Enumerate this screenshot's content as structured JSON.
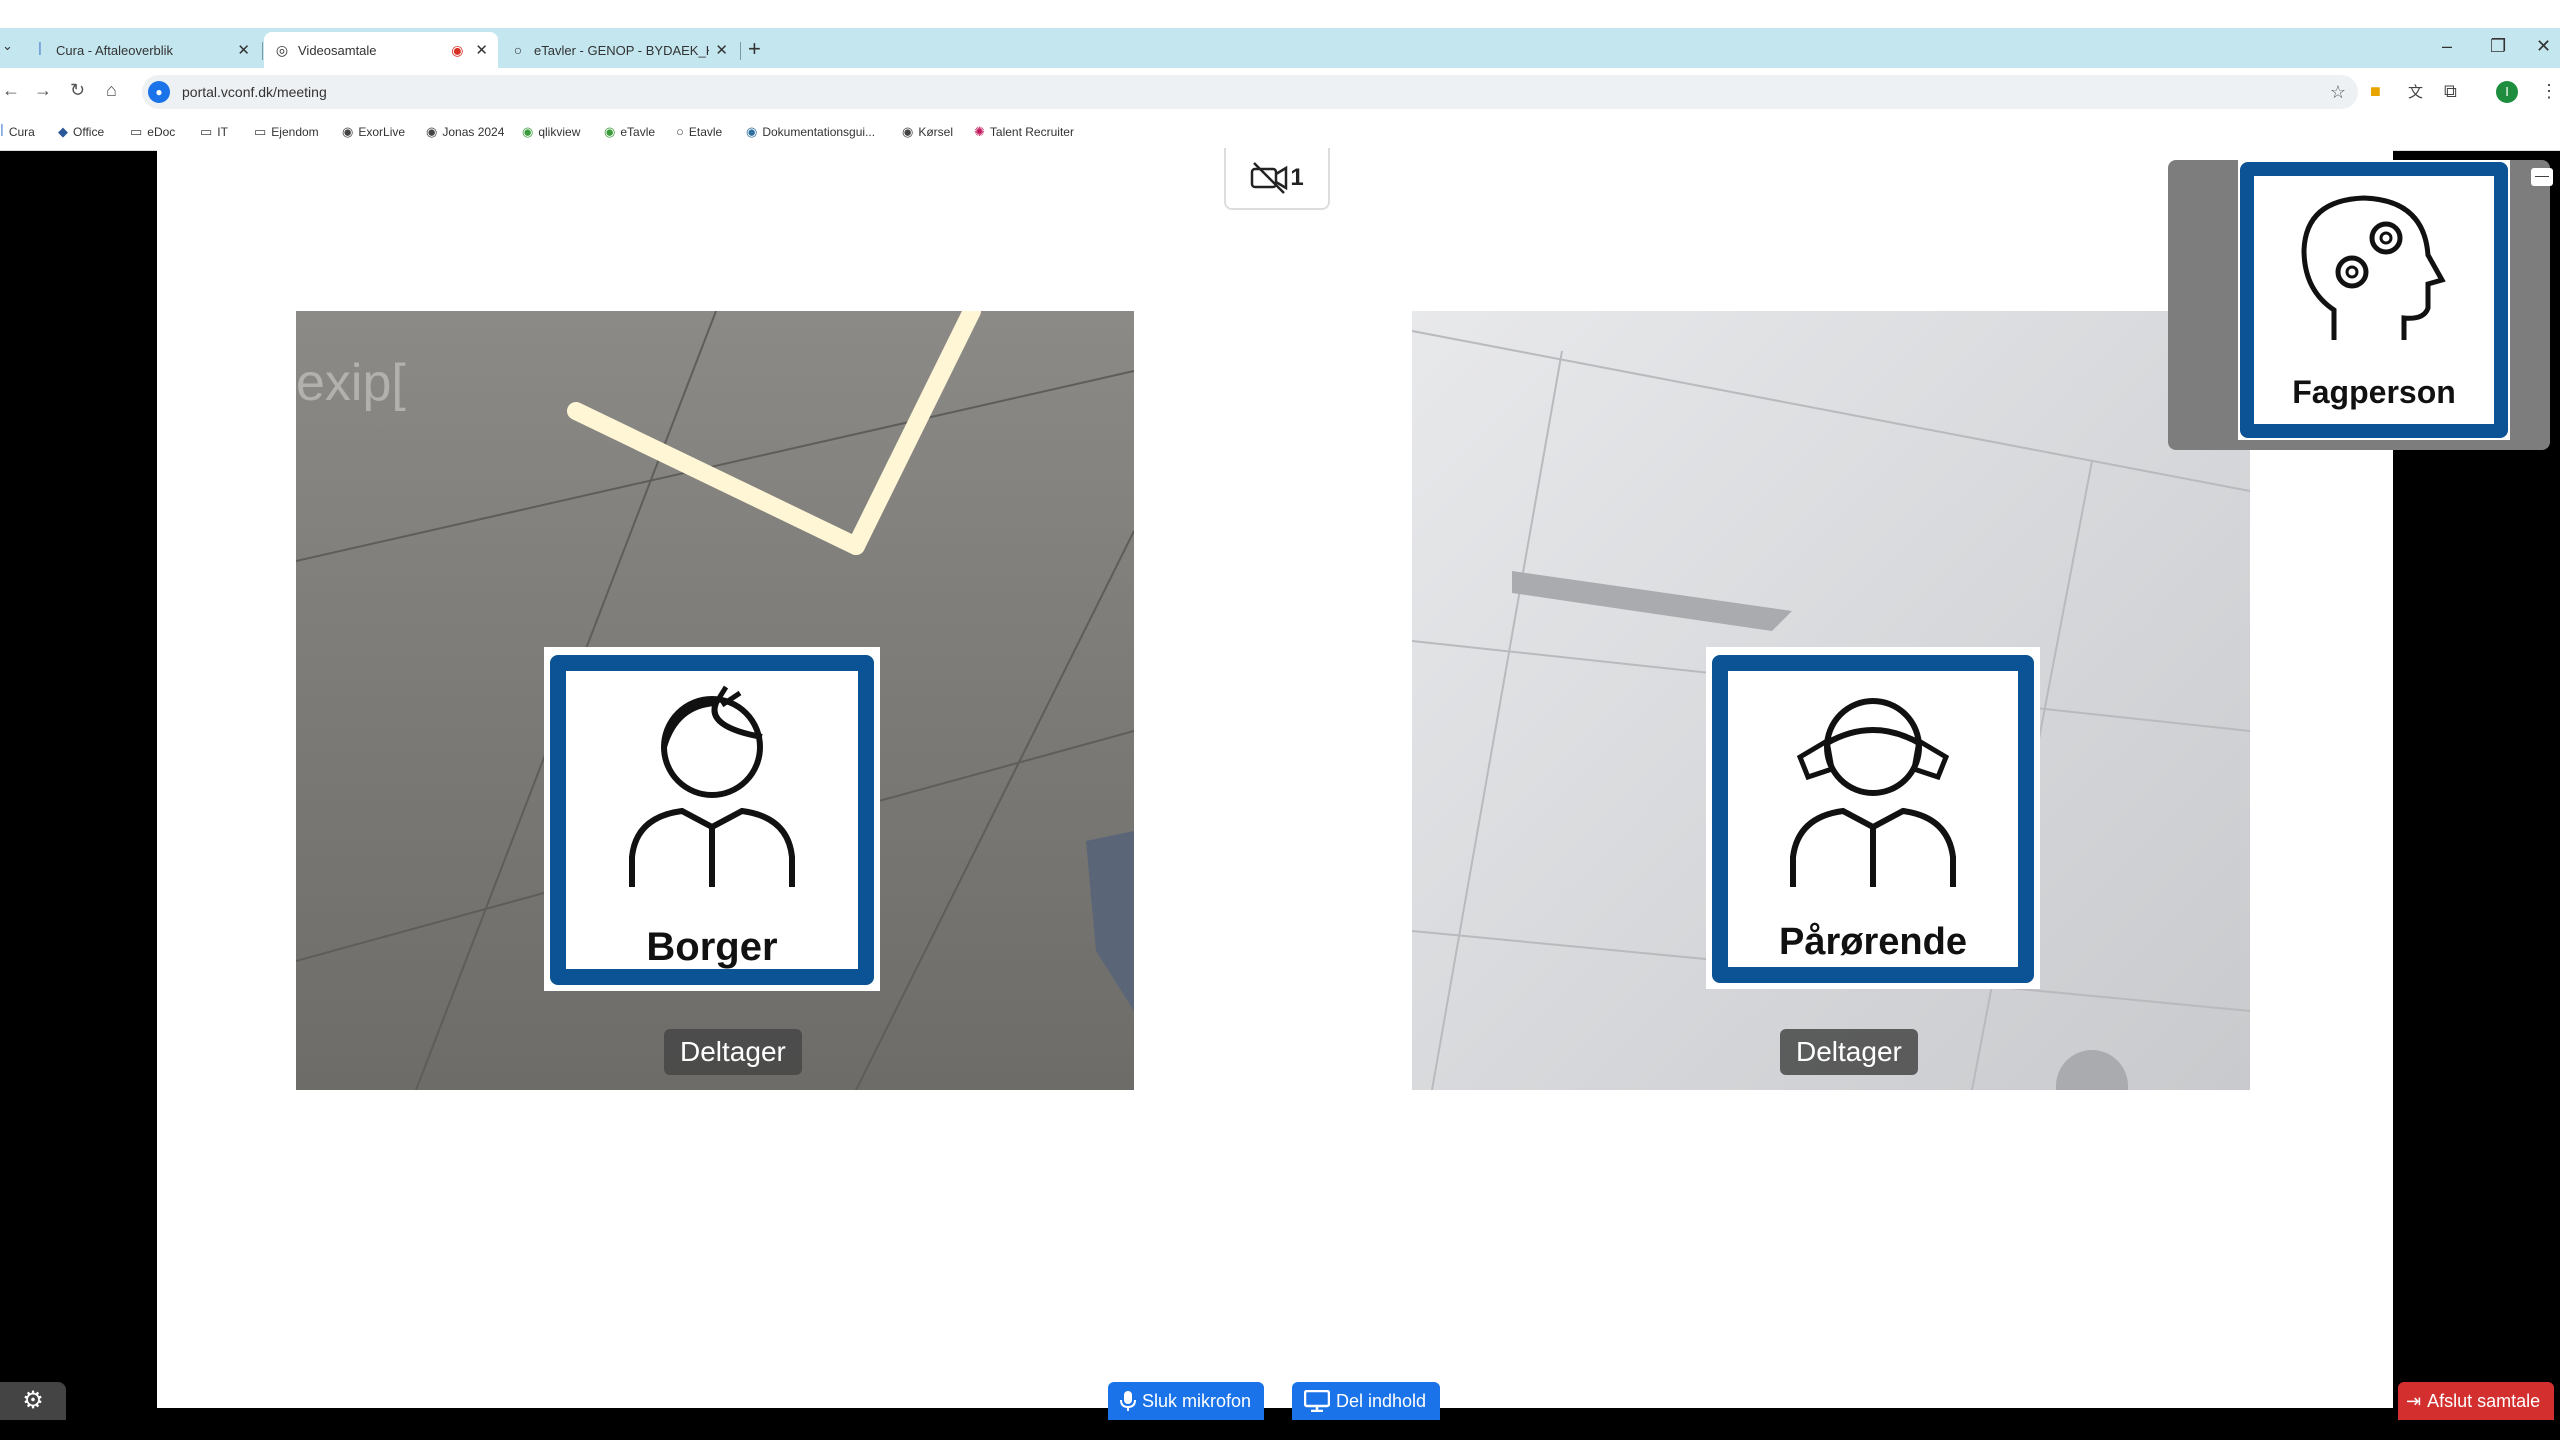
{
  "browser": {
    "tabs": [
      {
        "label": "Cura - Aftaleoverblik",
        "icon": "cura-icon"
      },
      {
        "label": "Videosamtale",
        "icon": "globe-icon",
        "recording": true
      },
      {
        "label": "eTavler - GENOP - BYDAEK_KR...",
        "icon": "circle-icon"
      }
    ],
    "url": "portal.vconf.dk/meeting",
    "bookmarks": [
      "Cura",
      "Office",
      "eDoc",
      "IT",
      "Ejendom",
      "ExorLive",
      "Jonas 2024",
      "qlikview",
      "eTavle",
      "Etavle",
      "Dokumentationsgui...",
      "Kørsel",
      "Talent Recruiter"
    ]
  },
  "meeting": {
    "camera_off_count": "1",
    "participants": [
      {
        "name": "Borger",
        "role": "Deltager",
        "watermark": "exip["
      },
      {
        "name": "Pårørende",
        "role": "Deltager"
      }
    ],
    "self_view": {
      "name": "Fagperson"
    }
  },
  "controls": {
    "mute_label": "Sluk mikrofon",
    "share_label": "Del indhold",
    "end_label": "Afslut samtale"
  },
  "colors": {
    "accent": "#1a73e8",
    "danger": "#d32f2f",
    "avatar_frame": "#0b5394",
    "tabstrip": "#c3e6ef"
  }
}
